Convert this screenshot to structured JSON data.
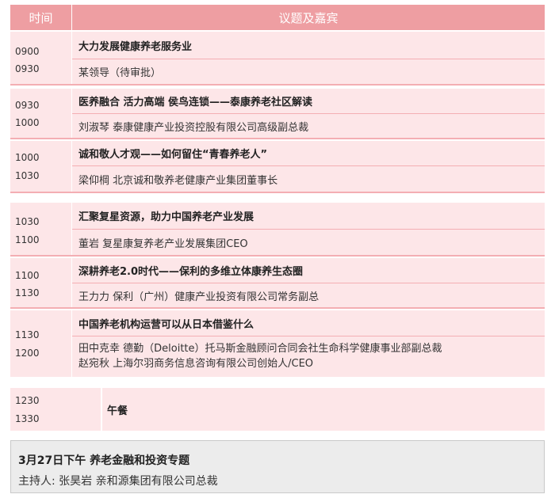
{
  "header": {
    "time_label": "时间",
    "topic_label": "议题及嘉宾"
  },
  "slots": [
    {
      "start": "0900",
      "end": "0930",
      "title": "大力发展健康养老服务业",
      "speakers": [
        "某领导（待审批）"
      ]
    },
    {
      "start": "0930",
      "end": "1000",
      "title": "医养融合 活力高端 侯鸟连锁——泰康养老社区解读",
      "speakers": [
        "刘淑琴   泰康健康产业投资控股有限公司高级副总裁"
      ]
    },
    {
      "start": "1000",
      "end": "1030",
      "title": "诚和敬人才观——如何留住“青春养老人”",
      "speakers": [
        "梁仰棡  北京诚和敬养老健康产业集团董事长"
      ]
    },
    {
      "start": "1030",
      "end": "1100",
      "title": "汇聚复星资源，助力中国养老产业发展",
      "speakers": [
        "董岩  复星康复养老产业发展集团CEO"
      ]
    },
    {
      "start": "1100",
      "end": "1130",
      "title": "深耕养老2.0时代——保利的多维立体康养生态圈",
      "speakers": [
        "王力力   保利（广州）健康产业投资有限公司常务副总"
      ]
    },
    {
      "start": "1130",
      "end": "1200",
      "title": "中国养老机构运营可以从日本借鉴什么",
      "speakers": [
        "田中克幸 德勤（Deloitte）托马斯金融顾问合同会社生命科学健康事业部副总裁",
        "赵宛秋  上海尔羽商务信息咨询有限公司创始人/CEO"
      ]
    }
  ],
  "lunch": {
    "start": "1230",
    "end": "1330",
    "label": "午餐"
  },
  "session": {
    "title": "3月27日下午   养老金融和投资专题",
    "host": "主持人: 张昊岩   亲和源集团有限公司总裁"
  }
}
